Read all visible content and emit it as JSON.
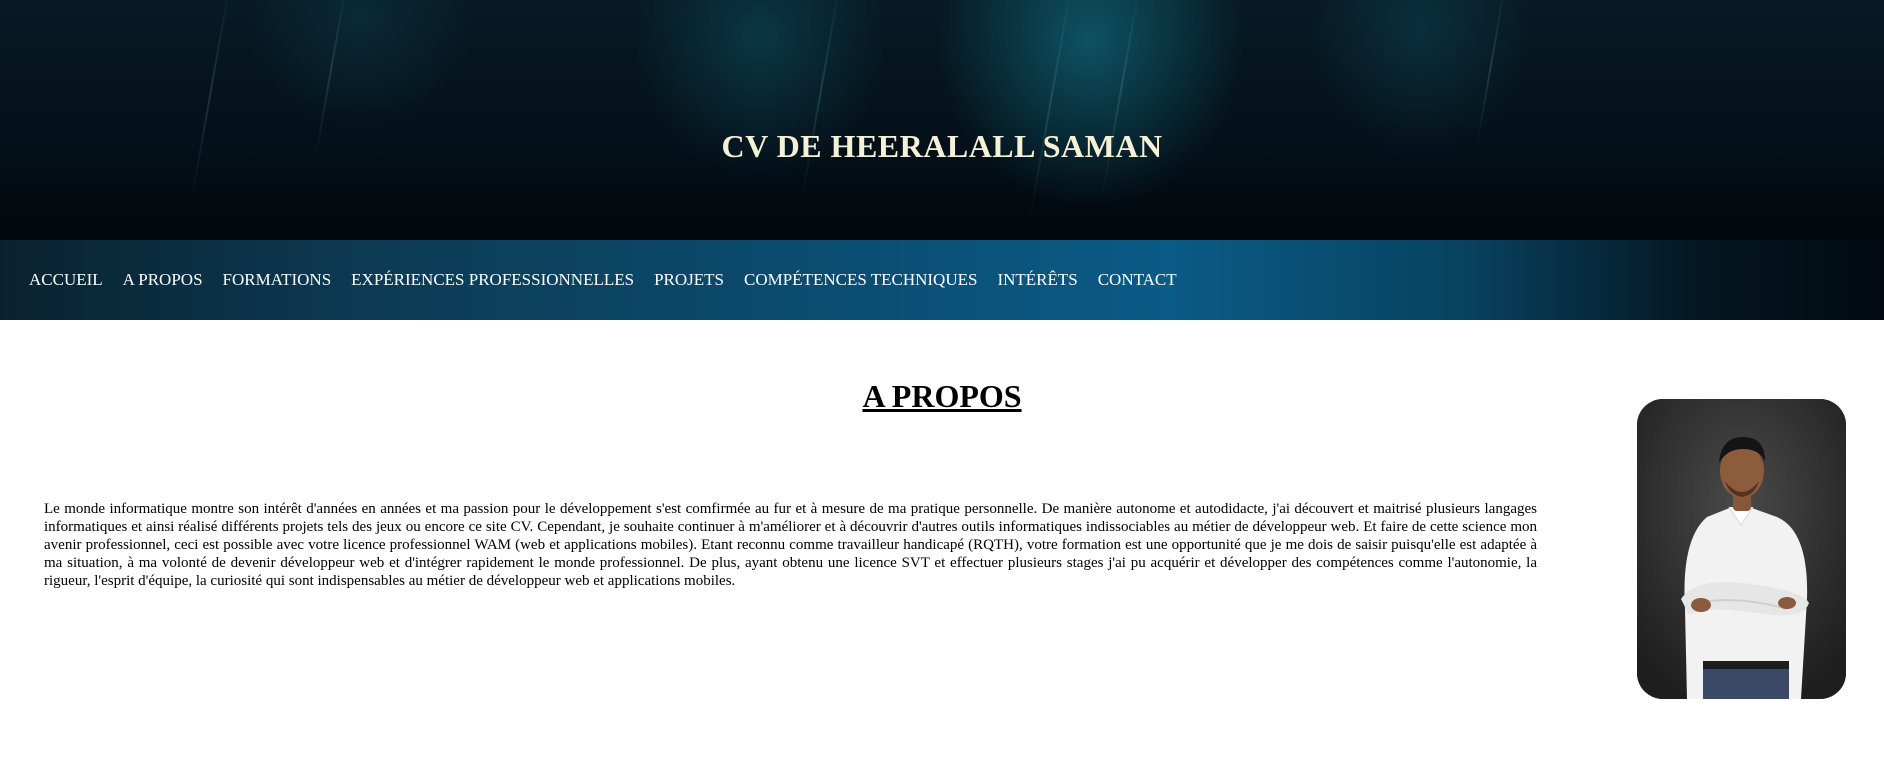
{
  "header": {
    "title": "CV DE HEERALALL SAMAN"
  },
  "nav": {
    "items": [
      {
        "label": "ACCUEIL"
      },
      {
        "label": "A PROPOS"
      },
      {
        "label": "FORMATIONS"
      },
      {
        "label": "EXPÉRIENCES PROFESSIONNELLES"
      },
      {
        "label": "PROJETS"
      },
      {
        "label": "COMPÉTENCES TECHNIQUES"
      },
      {
        "label": "INTÉRÊTS"
      },
      {
        "label": "CONTACT"
      }
    ]
  },
  "about": {
    "title": "A PROPOS",
    "text": "Le monde informatique montre son intérêt d'années en années et ma passion pour le développement s'est comfirmée au fur et à mesure de ma pratique personnelle. De manière autonome et autodidacte, j'ai découvert et maitrisé plusieurs langages informatiques et ainsi réalisé différents projets tels des jeux ou encore ce site CV. Cependant, je souhaite continuer à m'améliorer et à découvrir d'autres outils informatiques indissociables au métier de développeur web. Et faire de cette science mon avenir professionnel, ceci est possible avec votre licence professionnel WAM (web et applications mobiles). Etant reconnu comme travailleur handicapé (RQTH), votre formation est une opportunité que je me dois de saisir puisqu'elle est adaptée à ma situation, à ma volonté de devenir développeur web et d'intégrer rapidement le monde professionnel. De plus, ayant obtenu une licence SVT et effectuer plusieurs stages j'ai pu acquérir et développer des compétences comme l'autonomie, la rigueur, l'esprit d'équipe, la curiosité qui sont indispensables au métier de développeur web et applications mobiles."
  },
  "colors": {
    "title_color": "#f5f1d6",
    "nav_gradient_center": "#0a5b86",
    "hero_background": "#041019"
  }
}
